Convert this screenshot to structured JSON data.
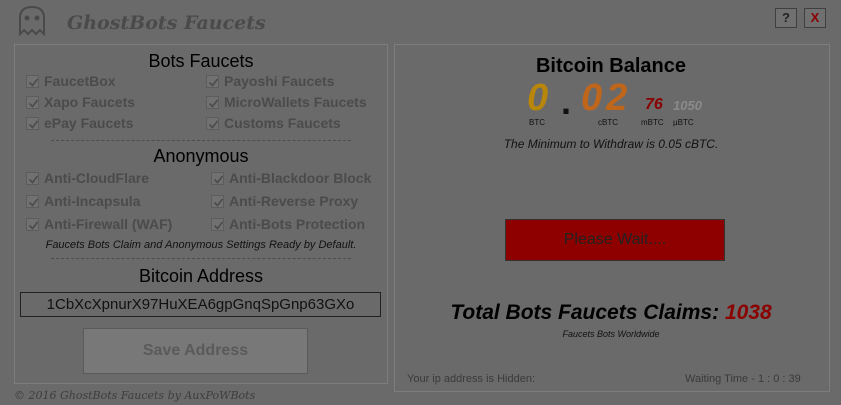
{
  "app": {
    "title": "GhostBots Faucets",
    "help_label": "?",
    "close_label": "X",
    "copyright": "© 2016 GhostBots Faucets by AuxPoWBots"
  },
  "faucets": {
    "title": "Bots Faucets",
    "items": [
      "FaucetBox",
      "Payoshi Faucets",
      "Xapo Faucets",
      "MicroWallets Faucets",
      "ePay Faucets",
      "Customs Faucets"
    ]
  },
  "anonymous": {
    "title": "Anonymous",
    "items": [
      "Anti-CloudFlare",
      "Anti-Blackdoor Block",
      "Anti-Incapsula",
      "Anti-Reverse Proxy",
      "Anti-Firewall (WAF)",
      "Anti-Bots Protection"
    ],
    "note": "Faucets Bots Claim and Anonymous Settings Ready by Default."
  },
  "address": {
    "title": "Bitcoin Address",
    "value": "1CbXcXpnurX97HuXEA6gpGnqSpGnp63GXo",
    "save_label": "Save Address"
  },
  "balance": {
    "title": "Bitcoin Balance",
    "btc": "0",
    "dot": ".",
    "cbtc": "02",
    "mbtc": "76",
    "ubtc": "1050",
    "unit_btc": "BTC",
    "unit_cbtc": "cBTC",
    "unit_mbtc": "mBTC",
    "unit_ubtc": "µBTC",
    "min_note": "The Minimum to Withdraw is 0.05 cBTC.",
    "wait_label": "Please Wait....",
    "claims_label": "Total Bots Faucets Claims:",
    "claims_value": "1038",
    "claims_sub": "Faucets Bots Worldwide",
    "ip_note": "Your ip address is Hidden:",
    "wait_time": "Waiting Time -  1  :  0  :  39"
  },
  "colors": {
    "background": "#6a6a6a",
    "btc_digit": "#b8860b",
    "cbtc_digit": "#c0661a",
    "mbtc_digit": "#8b0000",
    "ubtc_digit": "#8a8a8a",
    "button_red": "#8e0000",
    "claims_red": "#8b0000"
  },
  "icons": {
    "logo": "ghost-icon",
    "checkbox": "checkmark-icon"
  }
}
